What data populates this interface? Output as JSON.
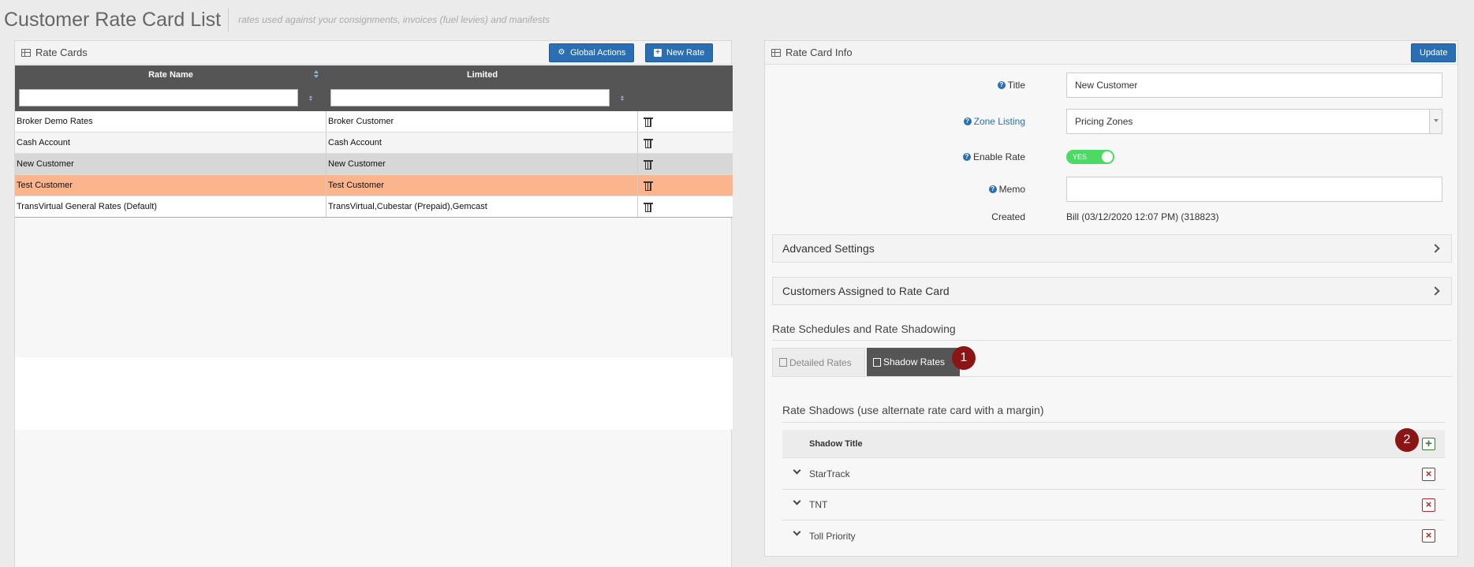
{
  "header": {
    "title": "Customer Rate Card List",
    "subtitle": "rates used against your consignments, invoices (fuel levies) and manifests"
  },
  "left_panel": {
    "title": "Rate Cards",
    "global_actions_label": "Global Actions",
    "new_rate_label": "New Rate",
    "columns": [
      "Rate Name",
      "Limited"
    ],
    "rows": [
      {
        "rate_name": "Broker Demo Rates",
        "limited": "Broker Customer",
        "state": "normal"
      },
      {
        "rate_name": "Cash Account",
        "limited": "Cash Account",
        "state": "alt"
      },
      {
        "rate_name": "New Customer",
        "limited": "New Customer",
        "state": "selected"
      },
      {
        "rate_name": "Test Customer",
        "limited": "Test Customer",
        "state": "highlighted"
      },
      {
        "rate_name": "TransVirtual General Rates (Default)",
        "limited": "TransVirtual,Cubestar (Prepaid),Gemcast",
        "state": "normal"
      }
    ]
  },
  "right_panel": {
    "title": "Rate Card Info",
    "update_label": "Update",
    "fields": {
      "title_label": "Title",
      "title_value": "New Customer",
      "zone_listing_label": "Zone Listing",
      "zone_listing_value": "Pricing Zones",
      "enable_rate_label": "Enable Rate",
      "enable_rate_value": "YES",
      "memo_label": "Memo",
      "memo_value": "",
      "created_label": "Created",
      "created_value": "Bill (03/12/2020 12:07 PM) (318823)"
    },
    "accordions": [
      "Advanced Settings",
      "Customers Assigned to Rate Card"
    ],
    "schedules_title": "Rate Schedules and Rate Shadowing",
    "tabs": [
      "Detailed Rates",
      "Shadow Rates"
    ],
    "active_tab": "Shadow Rates",
    "badges": [
      "1",
      "2"
    ],
    "shadows_title": "Rate Shadows (use alternate rate card with a margin)",
    "shadow_column": "Shadow Title",
    "shadows": [
      "StarTrack",
      "TNT",
      "Toll Priority"
    ]
  },
  "colors": {
    "primary_button": "#2a6fb3",
    "selected_row": "#d7d7d7",
    "highlighted_row": "#fbb58c",
    "toggle_on": "#4cd964",
    "badge": "#8b1414",
    "delete": "#b72a2a",
    "add": "#3a7d3a"
  }
}
